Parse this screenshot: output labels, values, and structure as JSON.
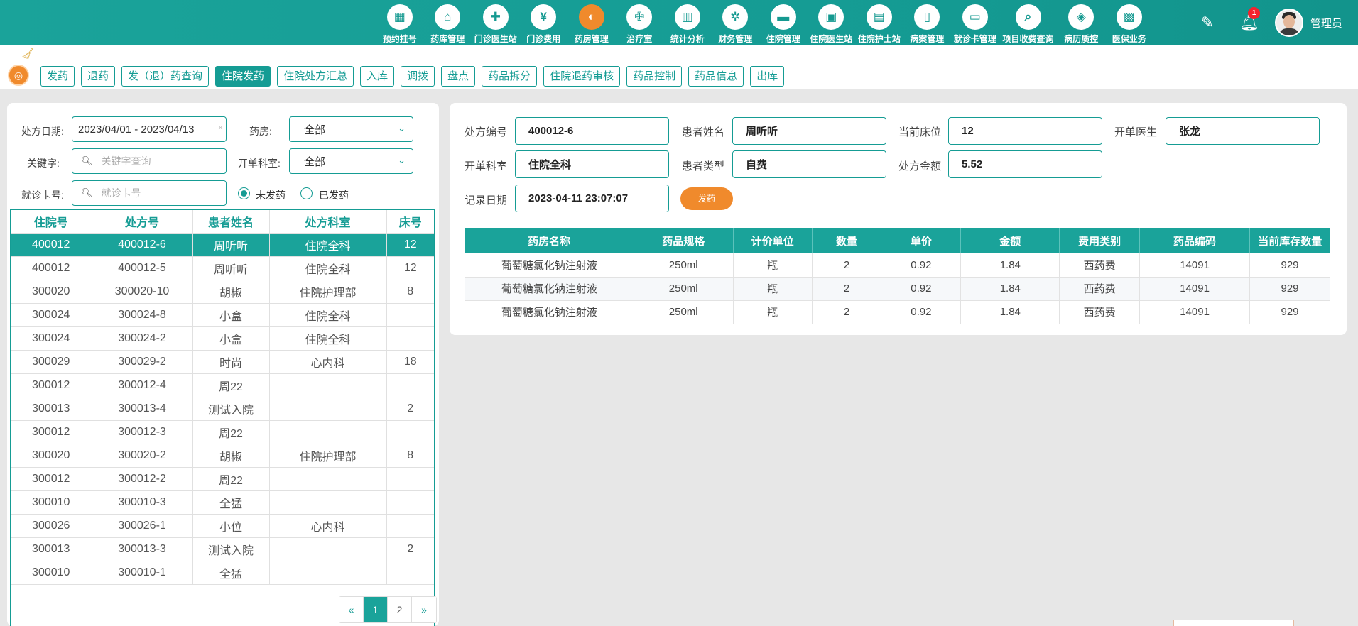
{
  "nav": {
    "items": [
      {
        "label": "预约挂号",
        "icon": "calendar-icon",
        "glyph": "▦"
      },
      {
        "label": "药库管理",
        "icon": "warehouse-icon",
        "glyph": "⌂"
      },
      {
        "label": "门诊医生站",
        "icon": "doctor-icon",
        "glyph": "✚"
      },
      {
        "label": "门诊费用",
        "icon": "yuan-icon",
        "glyph": "¥"
      },
      {
        "label": "药房管理",
        "icon": "pill-icon",
        "glyph": "◐"
      },
      {
        "label": "治疗室",
        "icon": "nurse-icon",
        "glyph": "✙"
      },
      {
        "label": "统计分析",
        "icon": "chart-icon",
        "glyph": "▥"
      },
      {
        "label": "财务管理",
        "icon": "gear-money-icon",
        "glyph": "✲"
      },
      {
        "label": "住院管理",
        "icon": "bed-icon",
        "glyph": "▬"
      },
      {
        "label": "住院医生站",
        "icon": "doctor-card-icon",
        "glyph": "▣"
      },
      {
        "label": "住院护士站",
        "icon": "nurse-card-icon",
        "glyph": "▤"
      },
      {
        "label": "病案管理",
        "icon": "record-icon",
        "glyph": "▯"
      },
      {
        "label": "就诊卡管理",
        "icon": "card-icon",
        "glyph": "▭"
      },
      {
        "label": "项目收费查询",
        "icon": "receipt-search-icon",
        "glyph": "⌕"
      },
      {
        "label": "病历质控",
        "icon": "shield-record-icon",
        "glyph": "◈"
      },
      {
        "label": "医保业务",
        "icon": "insurance-icon",
        "glyph": "▩"
      }
    ],
    "active_index": 4,
    "notification_count": "1",
    "user_name": "管理员"
  },
  "subnav": {
    "tabs": [
      "发药",
      "退药",
      "发（退）药查询",
      "住院发药",
      "住院处方汇总",
      "入库",
      "调拨",
      "盘点",
      "药品拆分",
      "住院退药审核",
      "药品控制",
      "药品信息",
      "出库"
    ],
    "active_index": 3
  },
  "filters": {
    "date_label": "处方日期:",
    "date_value": "2023/04/01 - 2023/04/13",
    "pharmacy_label": "药房:",
    "pharmacy_value": "全部",
    "keyword_label": "关键字:",
    "keyword_placeholder": "关键字查询",
    "dept_label": "开单科室:",
    "dept_value": "全部",
    "card_label": "就诊卡号:",
    "card_placeholder": "就诊卡号",
    "radio_undispensed": "未发药",
    "radio_dispensed": "已发药"
  },
  "left_table": {
    "headers": [
      "住院号",
      "处方号",
      "患者姓名",
      "处方科室",
      "床号"
    ],
    "rows": [
      [
        "400012",
        "400012-6",
        "周听听",
        "住院全科",
        "12"
      ],
      [
        "400012",
        "400012-5",
        "周听听",
        "住院全科",
        "12"
      ],
      [
        "300020",
        "300020-10",
        "胡椒",
        "住院护理部",
        "8"
      ],
      [
        "300024",
        "300024-8",
        "小盒",
        "住院全科",
        ""
      ],
      [
        "300024",
        "300024-2",
        "小盒",
        "住院全科",
        ""
      ],
      [
        "300029",
        "300029-2",
        "时尚",
        "心内科",
        "18"
      ],
      [
        "300012",
        "300012-4",
        "周22",
        "",
        ""
      ],
      [
        "300013",
        "300013-4",
        "测试入院",
        "",
        "2"
      ],
      [
        "300012",
        "300012-3",
        "周22",
        "",
        ""
      ],
      [
        "300020",
        "300020-2",
        "胡椒",
        "住院护理部",
        "8"
      ],
      [
        "300012",
        "300012-2",
        "周22",
        "",
        ""
      ],
      [
        "300010",
        "300010-3",
        "全猛",
        "",
        ""
      ],
      [
        "300026",
        "300026-1",
        "小位",
        "心内科",
        ""
      ],
      [
        "300013",
        "300013-3",
        "测试入院",
        "",
        "2"
      ],
      [
        "300010",
        "300010-1",
        "全猛",
        "",
        ""
      ]
    ],
    "selected_index": 0
  },
  "pager": {
    "prev": "«",
    "pages": [
      "1",
      "2"
    ],
    "next": "»",
    "current": "1"
  },
  "detail": {
    "rx_no_label": "处方编号",
    "rx_no": "400012-6",
    "patient_label": "患者姓名",
    "patient": "周听听",
    "bed_label": "当前床位",
    "bed": "12",
    "doctor_label": "开单医生",
    "doctor": "张龙",
    "dept_label": "开单科室",
    "dept": "住院全科",
    "ptype_label": "患者类型",
    "ptype": "自费",
    "amount_label": "处方金额",
    "amount": "5.52",
    "date_label": "记录日期",
    "date": "2023-04-11 23:07:07",
    "dispense_button": "发药"
  },
  "right_table": {
    "headers": [
      "药房名称",
      "药品规格",
      "计价单位",
      "数量",
      "单价",
      "金额",
      "费用类别",
      "药品编码",
      "当前库存数量"
    ],
    "rows": [
      [
        "葡萄糖氯化钠注射液",
        "250ml",
        "瓶",
        "2",
        "0.92",
        "1.84",
        "西药费",
        "14091",
        "929"
      ],
      [
        "葡萄糖氯化钠注射液",
        "250ml",
        "瓶",
        "2",
        "0.92",
        "1.84",
        "西药费",
        "14091",
        "929"
      ],
      [
        "葡萄糖氯化钠注射液",
        "250ml",
        "瓶",
        "2",
        "0.92",
        "1.84",
        "西药费",
        "14091",
        "929"
      ]
    ]
  }
}
